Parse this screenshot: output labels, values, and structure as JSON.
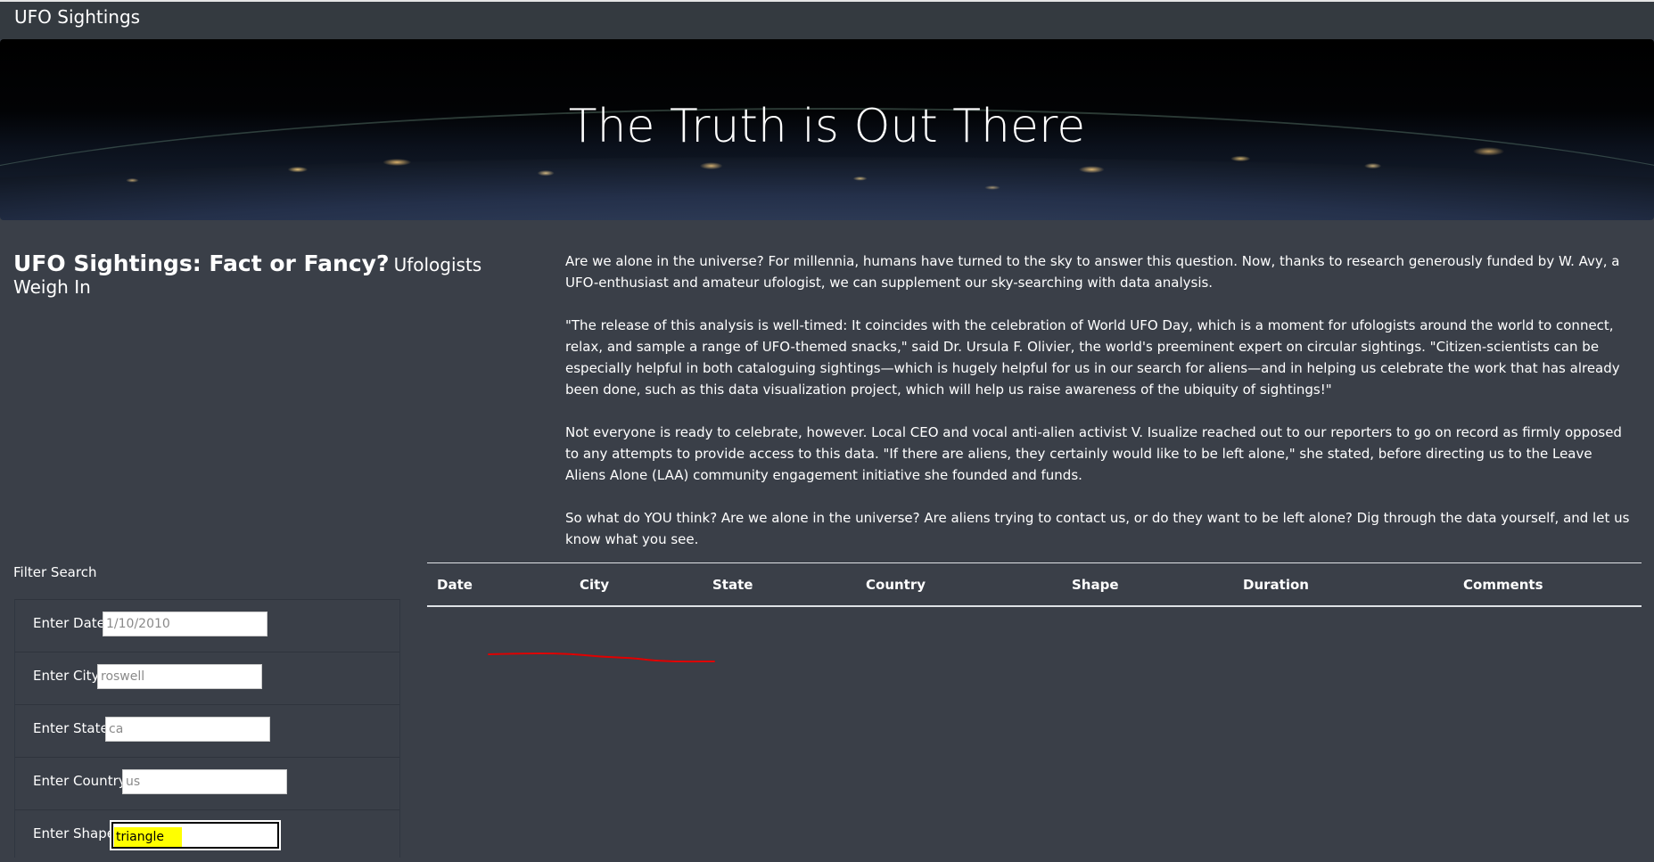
{
  "navbar": {
    "brand": "UFO Sightings"
  },
  "hero": {
    "title": "The Truth is Out There"
  },
  "article": {
    "heading": "UFO Sightings: Fact or Fancy?",
    "subheading": "Ufologists Weigh In",
    "paragraphs": [
      "Are we alone in the universe? For millennia, humans have turned to the sky to answer this question. Now, thanks to research generously funded by W. Avy, a UFO-enthusiast and amateur ufologist, we can supplement our sky-searching with data analysis.",
      "\"The release of this analysis is well-timed: It coincides with the celebration of World UFO Day, which is a moment for ufologists around the world to connect, relax, and sample a range of UFO-themed snacks,\" said Dr. Ursula F. Olivier, the world's preeminent expert on circular sightings. \"Citizen-scientists can be especially helpful in both cataloguing sightings—which is hugely helpful for us in our search for aliens—and in helping us celebrate the work that has already been done, such as this data visualization project, which will help us raise awareness of the ubiquity of sightings!\"",
      "Not everyone is ready to celebrate, however. Local CEO and vocal anti-alien activist V. Isualize reached out to our reporters to go on record as firmly opposed to any attempts to provide access to this data. \"If there are aliens, they certainly would like to be left alone,\" she stated, before directing us to the Leave Aliens Alone (LAA) community engagement initiative she founded and funds.",
      "So what do YOU think? Are we alone in the universe? Are aliens trying to contact us, or do they want to be left alone? Dig through the data yourself, and let us know what you see."
    ]
  },
  "filters": {
    "title": "Filter Search",
    "items": [
      {
        "label": "Enter Date",
        "placeholder": "1/10/2010",
        "value": ""
      },
      {
        "label": "Enter City",
        "placeholder": "roswell",
        "value": ""
      },
      {
        "label": "Enter State",
        "placeholder": "ca",
        "value": ""
      },
      {
        "label": "Enter Country",
        "placeholder": "us",
        "value": ""
      },
      {
        "label": "Enter Shape",
        "placeholder": "",
        "value": "triangle"
      }
    ]
  },
  "table": {
    "headers": [
      "Date",
      "City",
      "State",
      "Country",
      "Shape",
      "Duration",
      "Comments"
    ]
  },
  "colors": {
    "background": "#3a3f48",
    "navbar": "#343a40",
    "highlight": "#ffff00",
    "annotation": "#e00000"
  }
}
